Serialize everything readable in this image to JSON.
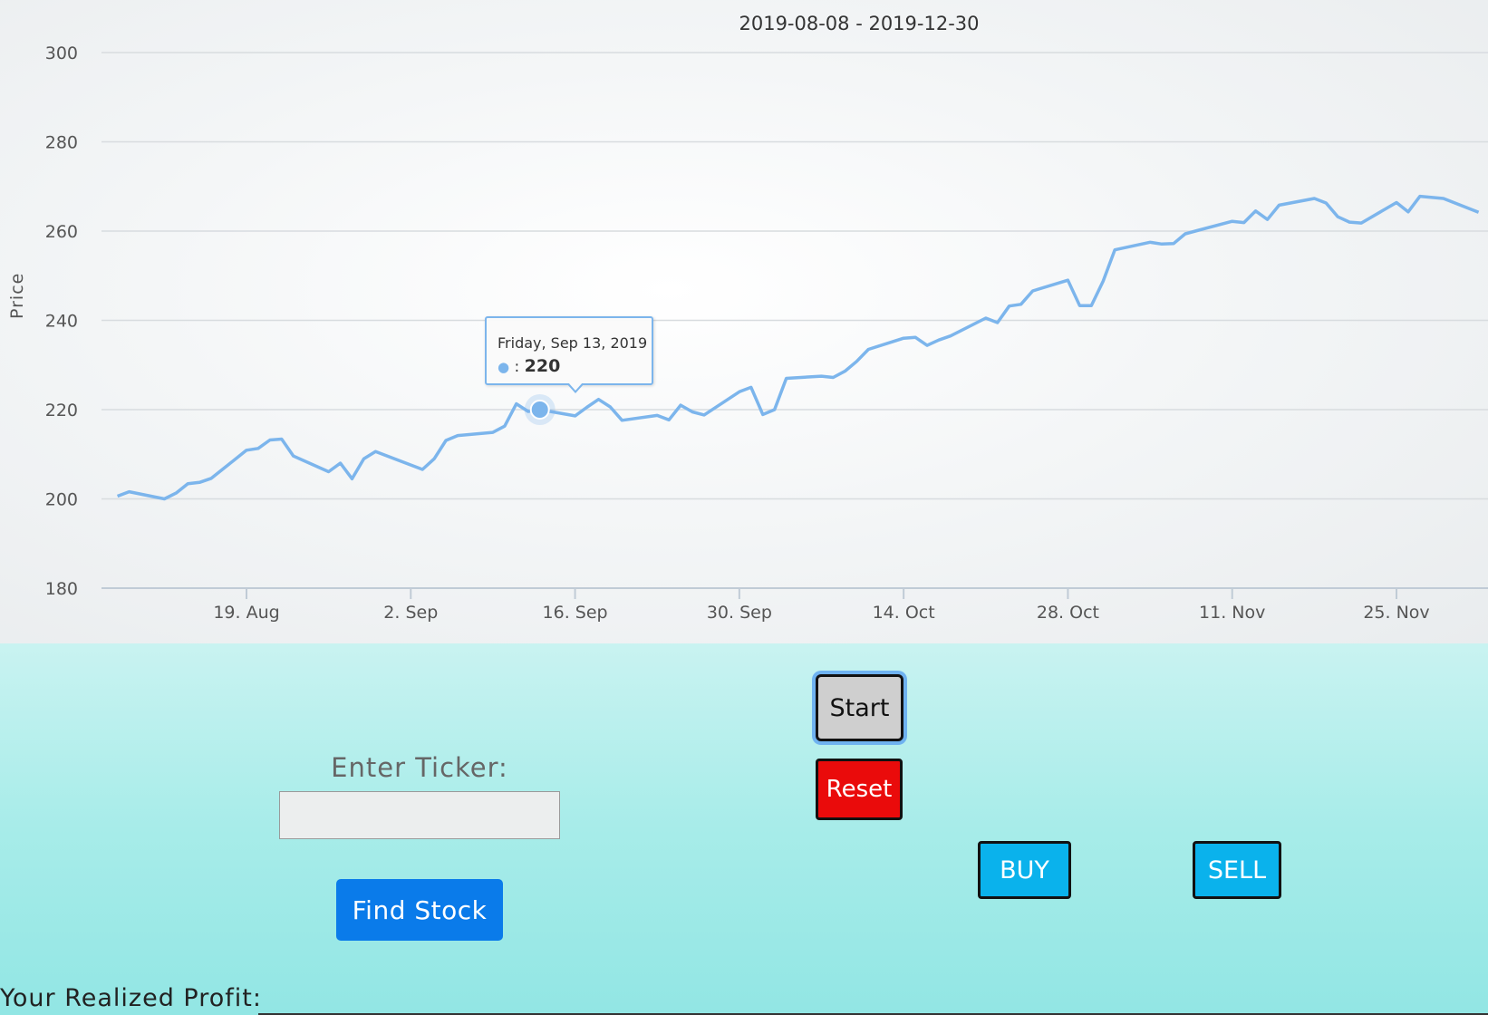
{
  "chart_data": {
    "type": "line",
    "title": "2019-08-08 - 2019-12-30",
    "ylabel": "Price",
    "ylim": [
      180,
      300
    ],
    "y_ticks": [
      300,
      280,
      260,
      240,
      220,
      200,
      180
    ],
    "x_ticks": [
      "19. Aug",
      "2. Sep",
      "16. Sep",
      "30. Sep",
      "14. Oct",
      "28. Oct",
      "11. Nov",
      "25. Nov"
    ],
    "x_tick_dates": [
      "2019-08-19",
      "2019-09-02",
      "2019-09-16",
      "2019-09-30",
      "2019-10-14",
      "2019-10-28",
      "2019-11-11",
      "2019-11-25"
    ],
    "color": "#7cb5ec",
    "grid": true,
    "series": [
      {
        "x": [
          "2019-08-08",
          "2019-08-09",
          "2019-08-12",
          "2019-08-13",
          "2019-08-14",
          "2019-08-15",
          "2019-08-16",
          "2019-08-19",
          "2019-08-20",
          "2019-08-21",
          "2019-08-22",
          "2019-08-23",
          "2019-08-26",
          "2019-08-27",
          "2019-08-28",
          "2019-08-29",
          "2019-08-30",
          "2019-09-03",
          "2019-09-04",
          "2019-09-05",
          "2019-09-06",
          "2019-09-09",
          "2019-09-10",
          "2019-09-11",
          "2019-09-12",
          "2019-09-13",
          "2019-09-16",
          "2019-09-17",
          "2019-09-18",
          "2019-09-19",
          "2019-09-20",
          "2019-09-23",
          "2019-09-24",
          "2019-09-25",
          "2019-09-26",
          "2019-09-27",
          "2019-09-30",
          "2019-10-01",
          "2019-10-02",
          "2019-10-03",
          "2019-10-04",
          "2019-10-07",
          "2019-10-08",
          "2019-10-09",
          "2019-10-10",
          "2019-10-11",
          "2019-10-14",
          "2019-10-15",
          "2019-10-16",
          "2019-10-17",
          "2019-10-18",
          "2019-10-21",
          "2019-10-22",
          "2019-10-23",
          "2019-10-24",
          "2019-10-25",
          "2019-10-28",
          "2019-10-29",
          "2019-10-30",
          "2019-10-31",
          "2019-11-01",
          "2019-11-04",
          "2019-11-05",
          "2019-11-06",
          "2019-11-07",
          "2019-11-08",
          "2019-11-11",
          "2019-11-12",
          "2019-11-13",
          "2019-11-14",
          "2019-11-15",
          "2019-11-18",
          "2019-11-19",
          "2019-11-20",
          "2019-11-21",
          "2019-11-22",
          "2019-11-25",
          "2019-11-26",
          "2019-11-27",
          "2019-11-29",
          "2019-12-02"
        ],
        "y": [
          200.6,
          201.6,
          200.0,
          201.3,
          203.4,
          203.7,
          204.6,
          210.9,
          211.3,
          213.2,
          213.4,
          209.6,
          206.1,
          208.0,
          204.5,
          209.0,
          210.6,
          206.6,
          209.0,
          213.1,
          214.2,
          214.9,
          216.3,
          221.3,
          219.6,
          220.0,
          218.6,
          220.5,
          222.3,
          220.6,
          217.6,
          218.7,
          217.7,
          221.0,
          219.5,
          218.8,
          224.0,
          225.0,
          218.9,
          220.0,
          227.0,
          227.5,
          227.2,
          228.6,
          230.8,
          233.5,
          236.0,
          236.2,
          234.4,
          235.6,
          236.5,
          240.5,
          239.5,
          243.2,
          243.6,
          246.6,
          249.0,
          243.3,
          243.3,
          248.8,
          255.8,
          257.5,
          257.1,
          257.2,
          259.4,
          260.1,
          262.2,
          261.9,
          264.5,
          262.6,
          265.8,
          267.3,
          266.3,
          263.2,
          262.0,
          261.8,
          266.4,
          264.3,
          267.8,
          267.3,
          264.2
        ]
      }
    ]
  },
  "tooltip": {
    "date": "Friday, Sep 13, 2019",
    "label": " : ",
    "value": "220"
  },
  "controls": {
    "ticker_label": "Enter Ticker:",
    "ticker_value": "",
    "find_stock_label": "Find Stock",
    "start_label": "Start",
    "reset_label": "Reset",
    "buy_label": "BUY",
    "sell_label": "SELL",
    "profit_label": "Your Realized Profit:",
    "colors": {
      "find_stock": "#0a7bea",
      "reset": "#ea0b0b",
      "buy_sell": "#0ab2ec",
      "start": "#cfcfcf"
    }
  }
}
